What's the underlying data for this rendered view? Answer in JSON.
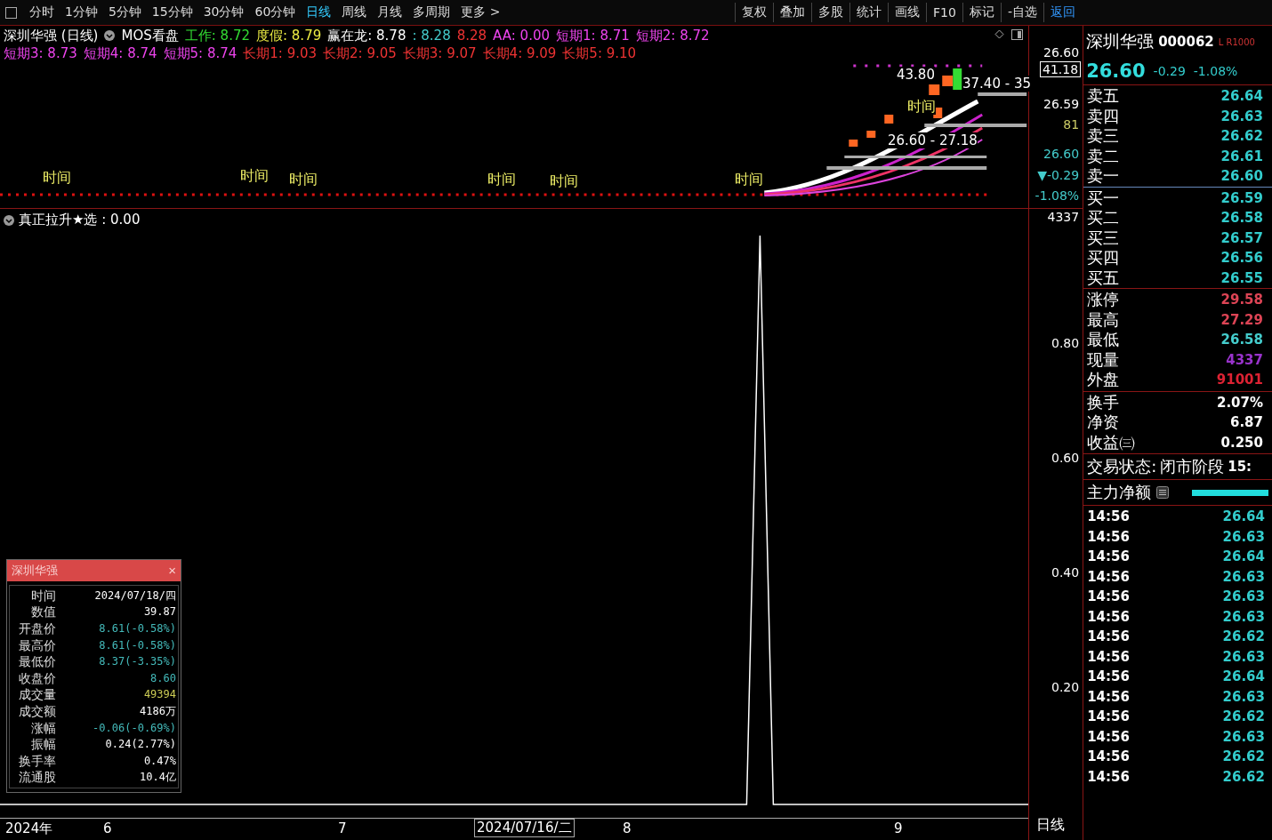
{
  "toolbar": {
    "periods": [
      {
        "label": "分时",
        "selected": false
      },
      {
        "label": "1分钟",
        "selected": false
      },
      {
        "label": "5分钟",
        "selected": false
      },
      {
        "label": "15分钟",
        "selected": false
      },
      {
        "label": "30分钟",
        "selected": false
      },
      {
        "label": "60分钟",
        "selected": false
      },
      {
        "label": "日线",
        "selected": true
      },
      {
        "label": "周线",
        "selected": false
      },
      {
        "label": "月线",
        "selected": false
      },
      {
        "label": "多周期",
        "selected": false
      },
      {
        "label": "更多 >",
        "selected": false
      }
    ],
    "actions": [
      {
        "label": "复权",
        "selected": false
      },
      {
        "label": "叠加",
        "selected": false
      },
      {
        "label": "多股",
        "selected": false
      },
      {
        "label": "统计",
        "selected": false
      },
      {
        "label": "画线",
        "selected": false
      },
      {
        "label": "F10",
        "selected": false
      },
      {
        "label": "标记",
        "selected": false
      },
      {
        "label": "-自选",
        "selected": false
      },
      {
        "label": "返回",
        "selected": true
      }
    ]
  },
  "main_chart": {
    "legend_lines": [
      [
        {
          "text": "深圳华强 (日线)",
          "color": "#ffffff"
        },
        {
          "text": "MOS看盘",
          "color": "#ffffff"
        },
        {
          "text": "工作: 8.72",
          "color": "#33dd33"
        },
        {
          "text": "度假: 8.79",
          "color": "#eeee44"
        },
        {
          "text": "赢在龙: 8.78",
          "color": "#ffffff"
        },
        {
          "text": ": 8.28",
          "color": "#44cccc"
        },
        {
          "text": "8.28",
          "color": "#ee3333"
        },
        {
          "text": "AA: 0.00",
          "color": "#ee44ee"
        },
        {
          "text": "短期1: 8.71",
          "color": "#ee44ee"
        },
        {
          "text": "短期2: 8.72",
          "color": "#ee44ee"
        }
      ],
      [
        {
          "text": "短期3: 8.73",
          "color": "#ee44ee"
        },
        {
          "text": "短期4: 8.74",
          "color": "#ee44ee"
        },
        {
          "text": "短期5: 8.74",
          "color": "#ee44ee"
        },
        {
          "text": "长期1: 9.03",
          "color": "#ee3333"
        },
        {
          "text": "长期2: 9.05",
          "color": "#ee3333"
        },
        {
          "text": "长期3: 9.07",
          "color": "#ee3333"
        },
        {
          "text": "长期4: 9.09",
          "color": "#ee3333"
        },
        {
          "text": "长期5: 9.10",
          "color": "#ee3333"
        }
      ]
    ],
    "labels": [
      {
        "text": "43.80",
        "kind": "price"
      },
      {
        "text": "37.40 - 35",
        "kind": "price"
      },
      {
        "text": "时间",
        "kind": "mark"
      },
      {
        "text": "26.60 - 27.18",
        "kind": "price"
      },
      {
        "text": "时间",
        "kind": "mark"
      },
      {
        "text": "时间",
        "kind": "mark"
      },
      {
        "text": "时间",
        "kind": "mark"
      },
      {
        "text": "时间",
        "kind": "mark"
      },
      {
        "text": "时间",
        "kind": "mark"
      },
      {
        "text": "时间",
        "kind": "mark"
      }
    ],
    "axis": [
      {
        "text": "26.60",
        "color": "#ffffff"
      },
      {
        "text": "41.18",
        "color": "#ffffff"
      },
      {
        "text": "26.59",
        "color": "#ffffff"
      },
      {
        "text": "81",
        "color": "#cccc66"
      },
      {
        "text": "26.60",
        "color": "#44cccc"
      },
      {
        "text": "▼-0.29",
        "color": "#44cccc"
      },
      {
        "text": "-1.08%",
        "color": "#44cccc"
      },
      {
        "text": "4337",
        "color": "#ffffff"
      }
    ]
  },
  "indicator": {
    "title": "真正拉升★选 : 0.00",
    "axis": [
      "0.80",
      "0.60",
      "0.40",
      "0.20"
    ]
  },
  "tooltip": {
    "title": "深圳华强",
    "close": "×",
    "rows": [
      {
        "label": "时间",
        "value": "2024/07/18/四",
        "color": "#ffffff"
      },
      {
        "label": "数值",
        "value": "39.87",
        "color": "#ffffff"
      },
      {
        "label": "开盘价",
        "value": "8.61(-0.58%)",
        "color": "#44bbbb"
      },
      {
        "label": "最高价",
        "value": "8.61(-0.58%)",
        "color": "#44bbbb"
      },
      {
        "label": "最低价",
        "value": "8.37(-3.35%)",
        "color": "#44bbbb"
      },
      {
        "label": "收盘价",
        "value": "8.60",
        "color": "#44bbbb"
      },
      {
        "label": "成交量",
        "value": "49394",
        "color": "#cccc55"
      },
      {
        "label": "成交额",
        "value": "4186万",
        "color": "#ffffff"
      },
      {
        "label": "涨幅",
        "value": "-0.06(-0.69%)",
        "color": "#44bbbb"
      },
      {
        "label": "振幅",
        "value": "0.24(2.77%)",
        "color": "#ffffff"
      },
      {
        "label": "换手率",
        "value": "0.47%",
        "color": "#ffffff"
      },
      {
        "label": "流通股",
        "value": "10.4亿",
        "color": "#ffffff"
      }
    ]
  },
  "time_axis": [
    {
      "text": "2024年",
      "selected": false
    },
    {
      "text": "6",
      "selected": false
    },
    {
      "text": "7",
      "selected": false
    },
    {
      "text": "2024/07/16/二",
      "selected": true
    },
    {
      "text": "8",
      "selected": false
    },
    {
      "text": "9",
      "selected": false
    }
  ],
  "period_label": "日线",
  "quote": {
    "name": "深圳华强",
    "code": "000062",
    "tag": "L R1000",
    "price": "26.60",
    "change": "-0.29",
    "percent": "-1.08%",
    "asks": [
      {
        "label": "卖五",
        "price": "26.64"
      },
      {
        "label": "卖四",
        "price": "26.63"
      },
      {
        "label": "卖三",
        "price": "26.62"
      },
      {
        "label": "卖二",
        "price": "26.61"
      },
      {
        "label": "卖一",
        "price": "26.60"
      }
    ],
    "bids": [
      {
        "label": "买一",
        "price": "26.59"
      },
      {
        "label": "买二",
        "price": "26.58"
      },
      {
        "label": "买三",
        "price": "26.57"
      },
      {
        "label": "买四",
        "price": "26.56"
      },
      {
        "label": "买五",
        "price": "26.55"
      }
    ],
    "stats": [
      {
        "label": "涨停",
        "value": "29.58",
        "color": "#dd4455"
      },
      {
        "label": "最高",
        "value": "27.29",
        "color": "#dd4455"
      },
      {
        "label": "最低",
        "value": "26.58",
        "color": "#44cccc"
      },
      {
        "label": "现量",
        "value": "4337",
        "color": "#9933cc"
      },
      {
        "label": "外盘",
        "value": "91001",
        "color": "#dd2233"
      }
    ],
    "fundamentals": [
      {
        "label": "换手",
        "value": "2.07%"
      },
      {
        "label": "净资",
        "value": "6.87"
      },
      {
        "label": "收益㈢",
        "value": "0.250"
      }
    ],
    "status_label": "交易状态:",
    "status_value": "闭市阶段",
    "status_time": "15:",
    "flow_label": "主力净额",
    "ticks": [
      {
        "time": "14:56",
        "price": "26.64"
      },
      {
        "time": "14:56",
        "price": "26.63"
      },
      {
        "time": "14:56",
        "price": "26.64"
      },
      {
        "time": "14:56",
        "price": "26.63"
      },
      {
        "time": "14:56",
        "price": "26.63"
      },
      {
        "time": "14:56",
        "price": "26.63"
      },
      {
        "time": "14:56",
        "price": "26.62"
      },
      {
        "time": "14:56",
        "price": "26.63"
      },
      {
        "time": "14:56",
        "price": "26.64"
      },
      {
        "time": "14:56",
        "price": "26.63"
      },
      {
        "time": "14:56",
        "price": "26.62"
      },
      {
        "time": "14:56",
        "price": "26.63"
      },
      {
        "time": "14:56",
        "price": "26.62"
      },
      {
        "time": "14:56",
        "price": "26.62"
      }
    ]
  }
}
